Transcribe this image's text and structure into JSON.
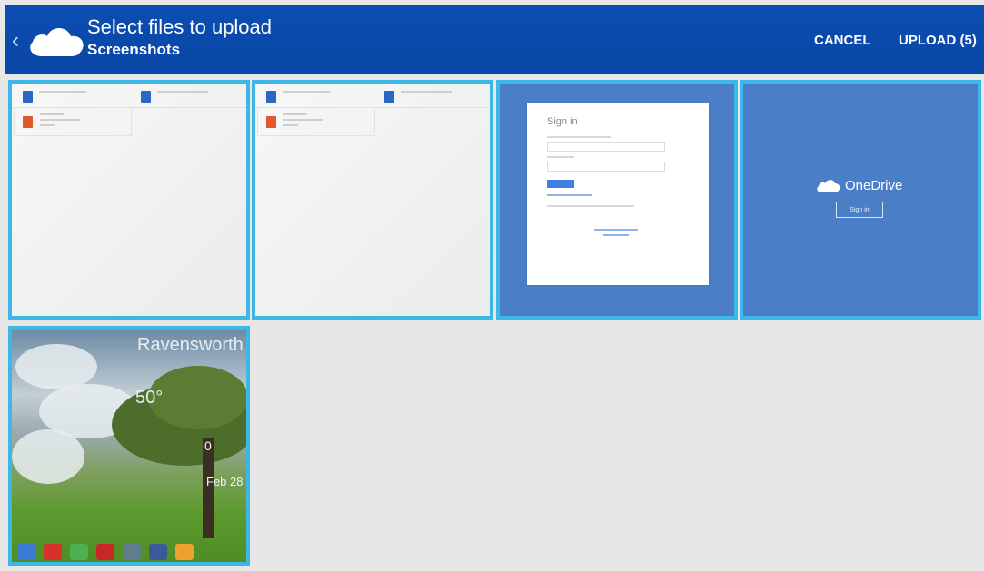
{
  "header": {
    "title": "Select files to upload",
    "subtitle": "Screenshots",
    "icons": {
      "up": "chevron-left-icon",
      "app": "onedrive-cloud-icon"
    },
    "actions": {
      "cancel": "CANCEL",
      "upload": "UPLOAD (5)"
    }
  },
  "tiles": [
    {
      "kind": "file-list-screenshot",
      "selected": true
    },
    {
      "kind": "file-list-screenshot",
      "selected": true
    },
    {
      "kind": "sign-in-screenshot",
      "selected": true,
      "card_title": "Sign in"
    },
    {
      "kind": "onedrive-start-screenshot",
      "selected": true,
      "brand": "OneDrive",
      "button": "Sign in"
    },
    {
      "kind": "home-screen-screenshot",
      "selected": true,
      "city": "Ravensworth",
      "temperature": "50°",
      "date": "Feb 28",
      "count": "0"
    }
  ],
  "colors": {
    "action_bar": "#0b4db1",
    "selection_border": "#3db7e6",
    "background": "#e7e7e7",
    "tile_blue": "#4a7fc7"
  }
}
